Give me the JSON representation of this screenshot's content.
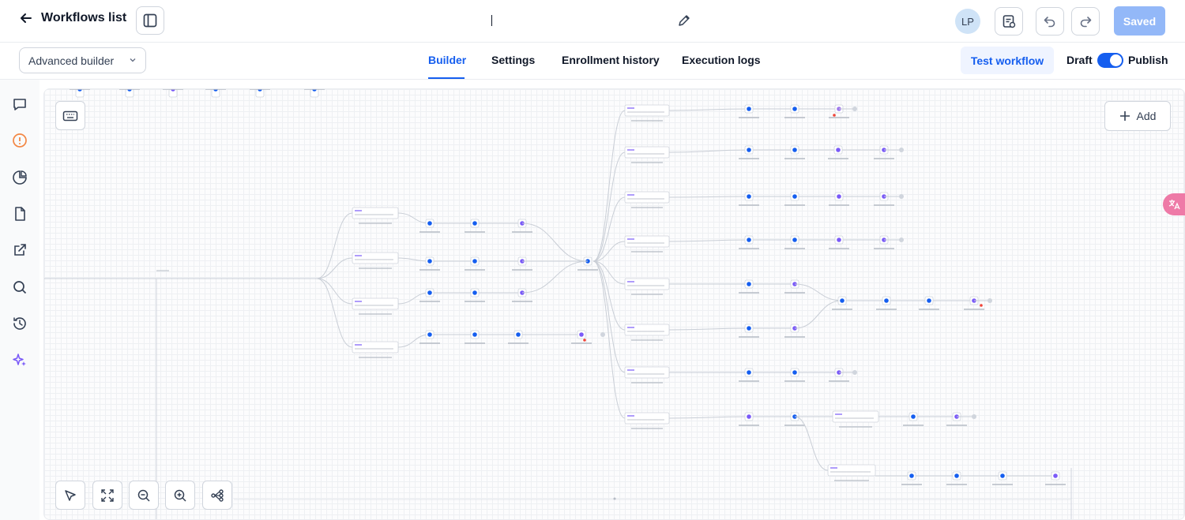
{
  "header": {
    "back_label": "Workflows list",
    "title_value": "",
    "avatar_initials": "LP",
    "save_label": "Saved"
  },
  "subbar": {
    "mode_select": "Advanced builder",
    "tabs": [
      {
        "label": "Builder",
        "active": true
      },
      {
        "label": "Settings",
        "active": false
      },
      {
        "label": "Enrollment history",
        "active": false
      },
      {
        "label": "Execution logs",
        "active": false
      }
    ],
    "test_label": "Test workflow",
    "draft_label": "Draft",
    "publish_label": "Publish",
    "published": true
  },
  "sidebar": {
    "icons": [
      "chat-icon",
      "alert-icon",
      "chart-icon",
      "document-icon",
      "external-link-icon",
      "search-icon",
      "history-icon",
      "sparkles-icon"
    ]
  },
  "canvas": {
    "add_label": "Add"
  },
  "colors": {
    "accent": "#155eef",
    "saved_bg": "#93b8f8",
    "tab_active": "#155eef",
    "alert_icon": "#f38744",
    "ai_icon": "#7a5af8"
  }
}
